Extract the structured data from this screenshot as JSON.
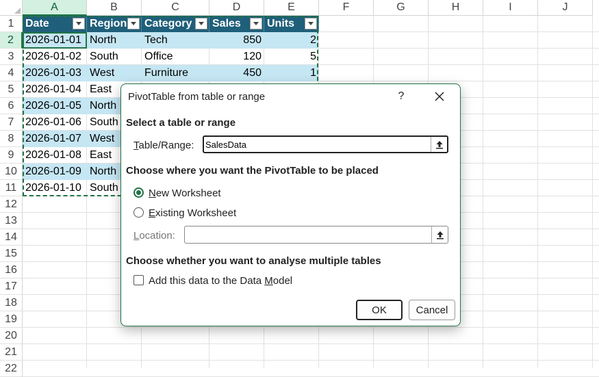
{
  "sheet": {
    "columns": [
      "A",
      "B",
      "C",
      "D",
      "E",
      "F",
      "G",
      "H",
      "I",
      "J"
    ],
    "rows": [
      "1",
      "2",
      "3",
      "4",
      "5",
      "6",
      "7",
      "8",
      "9",
      "10",
      "11",
      "12",
      "13",
      "14",
      "15",
      "16",
      "17",
      "18",
      "19",
      "20",
      "21",
      "22"
    ],
    "table_headers": [
      "Date",
      "Region",
      "Category",
      "Sales",
      "Units"
    ],
    "table_rows": [
      [
        "2026-01-01",
        "North",
        "Tech",
        "850",
        "2"
      ],
      [
        "2026-01-02",
        "South",
        "Office",
        "120",
        "5"
      ],
      [
        "2026-01-03",
        "West",
        "Furniture",
        "450",
        "1"
      ],
      [
        "2026-01-04",
        "East",
        "",
        "",
        ""
      ],
      [
        "2026-01-05",
        "North",
        "",
        "",
        ""
      ],
      [
        "2026-01-06",
        "South",
        "",
        "",
        ""
      ],
      [
        "2026-01-07",
        "West",
        "",
        "",
        ""
      ],
      [
        "2026-01-08",
        "East",
        "",
        "",
        ""
      ],
      [
        "2026-01-09",
        "North",
        "",
        "",
        ""
      ],
      [
        "2026-01-10",
        "South",
        "",
        "",
        ""
      ]
    ],
    "header_fill": "#1f5f7a",
    "band_fill": "#c5e6f3"
  },
  "dialog": {
    "title": "PivotTable from table or range",
    "help": "?",
    "section_select": "Select a table or range",
    "range_label_first": "T",
    "range_label_rest": "able/Range:",
    "range_value": "SalesData",
    "section_place": "Choose where you want the PivotTable to be placed",
    "new_ws_first": "N",
    "new_ws_rest": "ew Worksheet",
    "existing_ws_first": "E",
    "existing_ws_rest": "xisting Worksheet",
    "location_first": "L",
    "location_rest": "ocation:",
    "location_value": "",
    "section_multiple": "Choose whether you want to analyse multiple tables",
    "datamodel_pre": "Add this data to the Data ",
    "datamodel_u": "M",
    "datamodel_post": "odel",
    "ok": "OK",
    "cancel": "Cancel",
    "accent": "#217346"
  }
}
